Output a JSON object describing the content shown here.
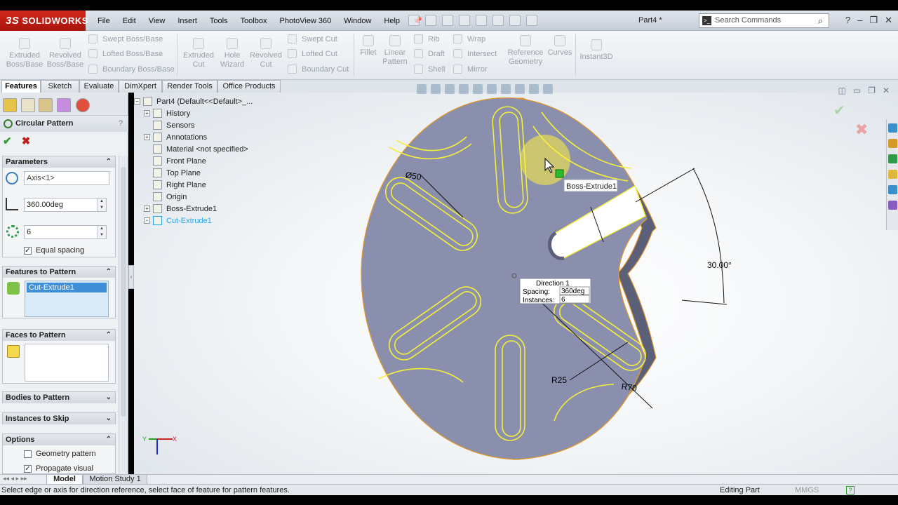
{
  "app": {
    "logo_text": "SOLIDWORKS",
    "doc_title": "Part4 *"
  },
  "menu": [
    "File",
    "Edit",
    "View",
    "Insert",
    "Tools",
    "Toolbox",
    "PhotoView 360",
    "Window",
    "Help"
  ],
  "search": {
    "placeholder": "Search Commands"
  },
  "command_manager": {
    "extruded_boss": "Extruded\nBoss/Base",
    "revolved_boss": "Revolved\nBoss/Base",
    "swept_boss": "Swept Boss/Base",
    "lofted_boss": "Lofted Boss/Base",
    "boundary_boss": "Boundary Boss/Base",
    "extruded_cut": "Extruded\nCut",
    "hole_wizard": "Hole\nWizard",
    "revolved_cut": "Revolved\nCut",
    "swept_cut": "Swept Cut",
    "lofted_cut": "Lofted Cut",
    "boundary_cut": "Boundary Cut",
    "fillet": "Fillet",
    "linear_pattern": "Linear\nPattern",
    "rib": "Rib",
    "draft": "Draft",
    "shell": "Shell",
    "wrap": "Wrap",
    "intersect": "Intersect",
    "mirror": "Mirror",
    "reference_geometry": "Reference\nGeometry",
    "curves": "Curves",
    "instant3d": "Instant3D"
  },
  "tabs": [
    "Features",
    "Sketch",
    "Evaluate",
    "DimXpert",
    "Render Tools",
    "Office Products"
  ],
  "property_manager": {
    "title": "Circular Pattern",
    "help": "?",
    "parameters": {
      "header": "Parameters",
      "axis": "Axis<1>",
      "angle": "360.00deg",
      "instances": "6",
      "equal_spacing": "Equal spacing",
      "equal_spacing_checked": true
    },
    "features_to_pattern": {
      "header": "Features to Pattern",
      "items": [
        "Cut-Extrude1"
      ]
    },
    "faces_to_pattern": {
      "header": "Faces to Pattern"
    },
    "bodies_to_pattern": {
      "header": "Bodies to Pattern"
    },
    "instances_to_skip": {
      "header": "Instances to Skip"
    },
    "options": {
      "header": "Options",
      "geometry_pattern": "Geometry pattern",
      "geometry_pattern_checked": false,
      "propagate_visual": "Propagate visual",
      "propagate_visual_checked": true
    }
  },
  "tree": {
    "root": "Part4  (Default<<Default>_...",
    "items": [
      "History",
      "Sensors",
      "Annotations",
      "Material <not specified>",
      "Front Plane",
      "Top Plane",
      "Right Plane",
      "Origin",
      "Boss-Extrude1",
      "Cut-Extrude1"
    ]
  },
  "graphics": {
    "tooltip": "Boss-Extrude1",
    "dim_diameter": "Ø50",
    "dim_angle": "30.00°",
    "dim_r25": "R25",
    "dim_r70": "R70",
    "callout": {
      "title": "Direction 1",
      "spacing_label": "Spacing:",
      "spacing_value": "360deg",
      "instances_label": "Instances:",
      "instances_value": "6"
    },
    "triad_x": "X",
    "triad_y": "Y",
    "colors": {
      "part": "#8a8fad",
      "edge_highlight": "#f5f03a",
      "preview": "#e8e000"
    }
  },
  "bottom_tabs": [
    "Model",
    "Motion Study 1"
  ],
  "status": {
    "message": "Select edge or axis for direction reference, select face of feature for pattern features.",
    "mode": "Editing Part",
    "units": "MMGS"
  }
}
